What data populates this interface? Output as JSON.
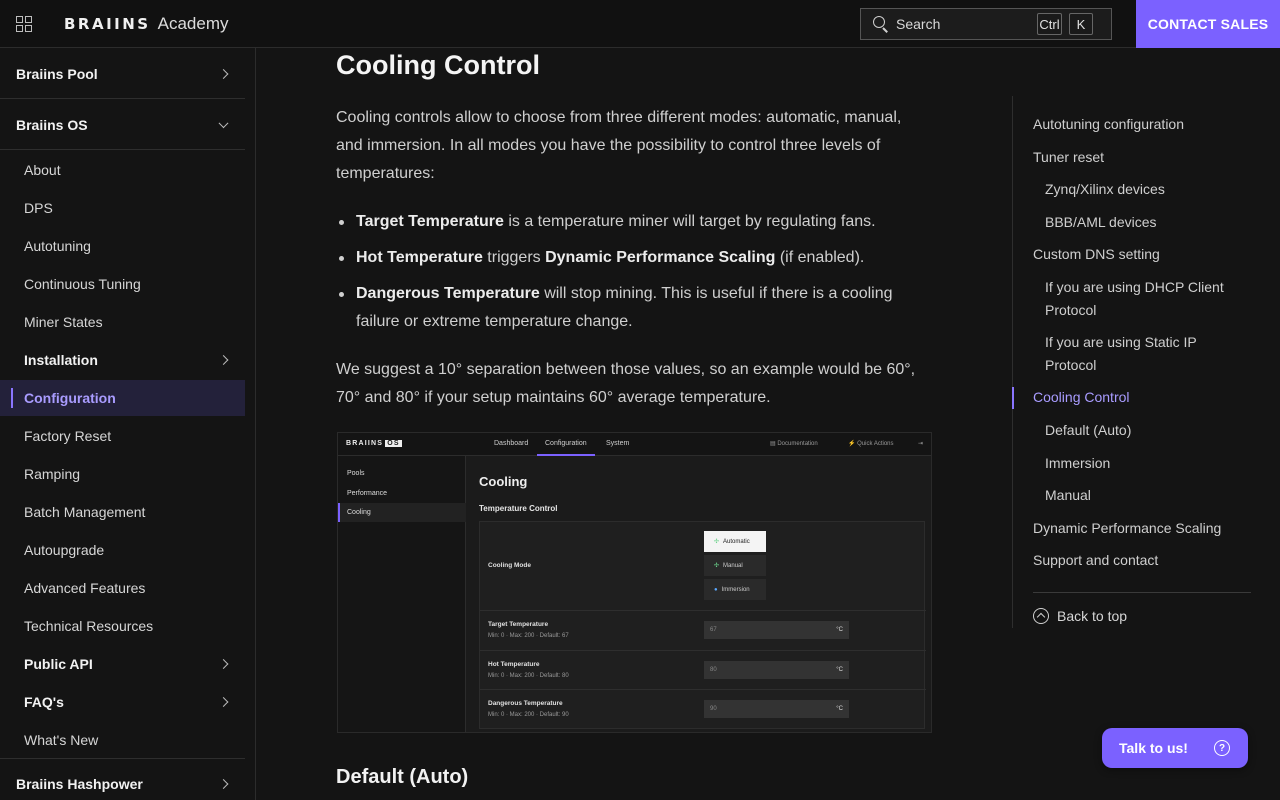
{
  "header": {
    "logo_mark": "BRAIINS",
    "logo_text": "Academy",
    "search_label": "Search",
    "shortcut_ctrl": "Ctrl",
    "shortcut_key": "K",
    "contact_label": "CONTACT SALES"
  },
  "sidebar": {
    "pool": "Braiins Pool",
    "os": "Braiins OS",
    "items": [
      {
        "label": "About"
      },
      {
        "label": "DPS"
      },
      {
        "label": "Autotuning"
      },
      {
        "label": "Continuous Tuning"
      },
      {
        "label": "Miner States"
      },
      {
        "label": "Installation"
      },
      {
        "label": "Configuration"
      },
      {
        "label": "Factory Reset"
      },
      {
        "label": "Ramping"
      },
      {
        "label": "Batch Management"
      },
      {
        "label": "Autoupgrade"
      },
      {
        "label": "Advanced Features"
      },
      {
        "label": "Technical Resources"
      },
      {
        "label": "Public API"
      },
      {
        "label": "FAQ's"
      },
      {
        "label": "What's New"
      }
    ],
    "hashpower": "Braiins Hashpower"
  },
  "article": {
    "title": "Cooling Control",
    "intro": "Cooling controls allow to choose from three different modes: automatic, manual, and immersion. In all modes you have the possibility to control three levels of temperatures:",
    "bullets": [
      {
        "term": "Target Temperature",
        "text": " is a temperature miner will target by regulating fans."
      },
      {
        "term": "Hot Temperature",
        "text": " triggers ",
        "term2": "Dynamic Performance Scaling",
        "text2": " (if enabled)."
      },
      {
        "term": "Dangerous Temperature",
        "text": " will stop mining. This is useful if there is a cooling failure or extreme temperature change."
      }
    ],
    "suggestion": "We suggest a 10° separation between those values, so an example would be 60°, 70° and 80° if your setup maintains 60° average temperature.",
    "next_heading": "Default (Auto)"
  },
  "screenshot": {
    "logo": "BRAIINS",
    "logo_badge": "OS",
    "tabs": [
      "Dashboard",
      "Configuration",
      "System"
    ],
    "right_links": [
      "Documentation",
      "Quick Actions"
    ],
    "side": [
      "Pools",
      "Performance",
      "Cooling"
    ],
    "heading": "Cooling",
    "subheading": "Temperature Control",
    "mode_label": "Cooling Mode",
    "modes": [
      "Automatic",
      "Manual",
      "Immersion"
    ],
    "rows": [
      {
        "label": "Target Temperature",
        "hint": "Min: 0  ·  Max: 200  ·  Default: 67",
        "value": "67",
        "unit": "°C"
      },
      {
        "label": "Hot Temperature",
        "hint": "Min: 0  ·  Max: 200  ·  Default: 80",
        "value": "80",
        "unit": "°C"
      },
      {
        "label": "Dangerous Temperature",
        "hint": "Min: 0  ·  Max: 200  ·  Default: 90",
        "value": "90",
        "unit": "°C"
      }
    ]
  },
  "toc": {
    "items": [
      {
        "label": "Autotuning configuration"
      },
      {
        "label": "Tuner reset"
      },
      {
        "label": "Zynq/Xilinx devices"
      },
      {
        "label": "BBB/AML devices"
      },
      {
        "label": "Custom DNS setting"
      },
      {
        "label": "If you are using DHCP Client Protocol"
      },
      {
        "label": "If you are using Static IP Protocol"
      },
      {
        "label": "Cooling Control"
      },
      {
        "label": "Default (Auto)"
      },
      {
        "label": "Immersion"
      },
      {
        "label": "Manual"
      },
      {
        "label": "Dynamic Performance Scaling"
      },
      {
        "label": "Support and contact"
      }
    ],
    "back_to_top": "Back to top"
  },
  "chat": {
    "label": "Talk to us!",
    "help_glyph": "?"
  },
  "colors": {
    "accent": "#7b61ff",
    "active_text": "#a99cff",
    "background": "#141414"
  }
}
